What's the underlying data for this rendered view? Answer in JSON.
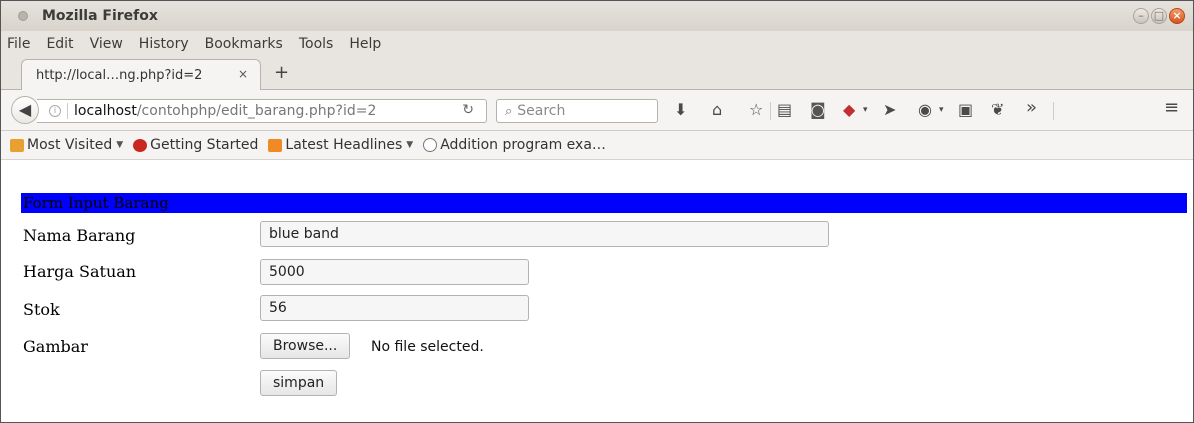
{
  "window": {
    "title": "Mozilla Firefox"
  },
  "menu": [
    "File",
    "Edit",
    "View",
    "History",
    "Bookmarks",
    "Tools",
    "Help"
  ],
  "tab": {
    "title": "http://local…ng.php?id=2",
    "close": "×",
    "new_tab": "+"
  },
  "address": {
    "host": "localhost",
    "path": "/contohphp/edit_barang.php?id=2"
  },
  "search": {
    "placeholder": "Search"
  },
  "bookmarks": [
    {
      "label": "Most Visited",
      "dropdown": true
    },
    {
      "label": "Getting Started",
      "dropdown": false
    },
    {
      "label": "Latest Headlines",
      "dropdown": true
    },
    {
      "label": "Addition program exa…",
      "dropdown": false
    }
  ],
  "form": {
    "header": "Form Input Barang",
    "nama_label": "Nama Barang",
    "nama_value": "blue band",
    "harga_label": "Harga Satuan",
    "harga_value": "5000",
    "stok_label": "Stok",
    "stok_value": "56",
    "gambar_label": "Gambar",
    "browse_label": "Browse...",
    "file_status": "No file selected.",
    "submit_label": "simpan"
  },
  "colors": {
    "form_header_bg": "#0000ff",
    "close_button": "#e05a24"
  }
}
